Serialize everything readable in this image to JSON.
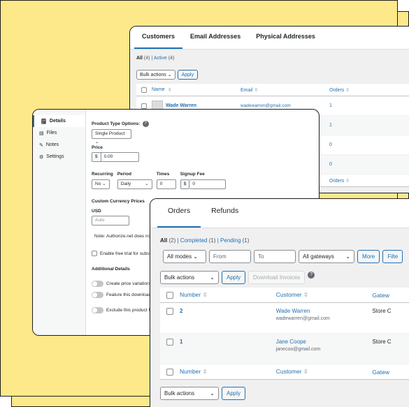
{
  "customers_panel": {
    "tabs": [
      "Customers",
      "Email Addresses",
      "Physical Addresses"
    ],
    "views": {
      "all_label": "All",
      "all_count": "(4)",
      "sep": "|",
      "active_label": "Active",
      "active_count": "(4)"
    },
    "bulk_select": "Bulk actions",
    "apply_label": "Apply",
    "columns": {
      "name": "Name",
      "email": "Email",
      "orders": "Orders"
    },
    "rows": [
      {
        "name": "Wade Warren",
        "email": "wadewarren@gmail.com",
        "orders": "1"
      },
      {
        "name": "",
        "email": "",
        "orders": "1"
      },
      {
        "name": "",
        "email": "",
        "orders": "0"
      },
      {
        "name": "",
        "email": "",
        "orders": "0"
      }
    ],
    "footer_orders": "Orders"
  },
  "product_panel": {
    "sidebar": [
      {
        "label": "Details",
        "icon": "receipt-icon"
      },
      {
        "label": "Files",
        "icon": "files-icon"
      },
      {
        "label": "Notes",
        "icon": "pencil-icon"
      },
      {
        "label": "Settings",
        "icon": "gear-icon"
      }
    ],
    "type_label": "Product Type Options:",
    "type_value": "Single Product",
    "price_label": "Price",
    "currency_symbol": "$",
    "price_value": "0.00",
    "recurring_label": "Recurring",
    "recurring_value": "No",
    "period_label": "Period",
    "period_value": "Daily",
    "times_label": "Times",
    "times_value": "0",
    "signup_label": "Signup Fee",
    "signup_value": "0",
    "custom_currency_label": "Custom Currency Prices",
    "usd_label": "USD",
    "usd_placeholder": "Auto",
    "note_text": "Note: Authorize.net does not a",
    "free_trial_text": "Enable free trial for subscrip",
    "additional_label": "Additional Details",
    "toggles": [
      "Create price variations f",
      "Feature this download in",
      "Exclude this product fro"
    ]
  },
  "orders_panel": {
    "tabs": [
      "Orders",
      "Refunds"
    ],
    "views": {
      "all_label": "All",
      "all_count": "(2)",
      "completed_label": "Completed",
      "completed_count": "(1)",
      "pending_label": "Pending",
      "pending_count": "(1)",
      "sep": "|"
    },
    "modes_select": "All modes",
    "from_placeholder": "From",
    "to_placeholder": "To",
    "gateways_select": "All gateways",
    "more_label": "More",
    "filter_label": "Filte",
    "bulk_select": "Bulk actions",
    "apply_label": "Apply",
    "download_label": "Download Invoices",
    "columns": {
      "number": "Number",
      "customer": "Customer",
      "gateway": "Gatew"
    },
    "rows": [
      {
        "number": "2",
        "name": "Wade Warren",
        "email": "wadewarren@gmail.com",
        "gateway": "Store C"
      },
      {
        "number": "1",
        "name": "Jane Coope",
        "email": "janecoo@gmail.com",
        "gateway": "Store C"
      }
    ]
  }
}
